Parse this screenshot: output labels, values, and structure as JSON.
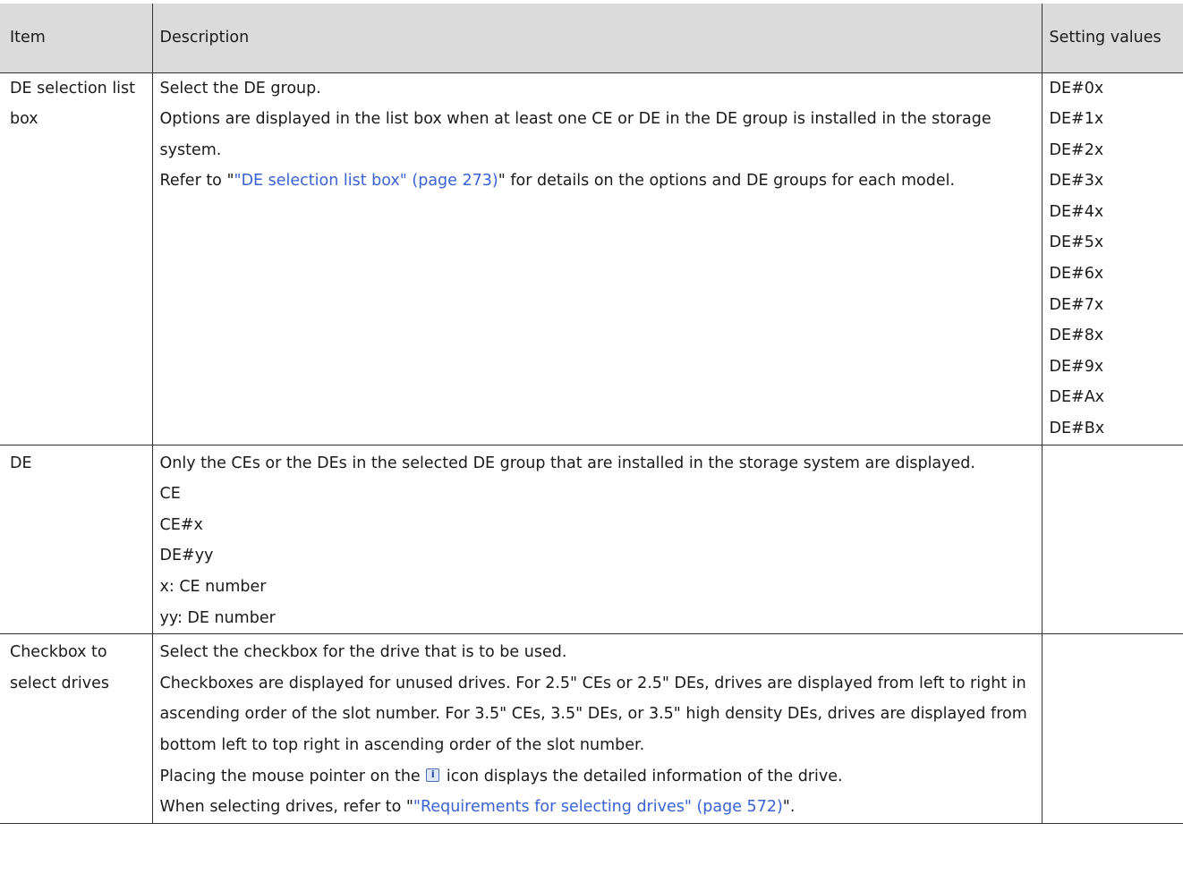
{
  "table": {
    "headers": {
      "item": "Item",
      "description": "Description",
      "setting_values": "Setting values"
    },
    "rows": [
      {
        "item": "DE selection list box",
        "description": {
          "line1": "Select the DE group.",
          "line2": "Options are displayed in the list box when at least one CE or DE in the DE group is installed in the storage system.",
          "ref_prefix": "Refer to \"",
          "ref_link": "\"DE selection list box\" (page 273)",
          "ref_suffix": "\" for details on the options and DE groups for each model."
        },
        "values": [
          "DE#0x",
          "DE#1x",
          "DE#2x",
          "DE#3x",
          "DE#4x",
          "DE#5x",
          "DE#6x",
          "DE#7x",
          "DE#8x",
          "DE#9x",
          "DE#Ax",
          "DE#Bx"
        ]
      },
      {
        "item": "DE",
        "description": {
          "line1": "Only the CEs or the DEs in the selected DE group that are installed in the storage system are displayed.",
          "list": [
            "CE",
            "CE#x",
            "DE#yy",
            "x: CE number",
            "yy: DE number"
          ]
        }
      },
      {
        "item": "Checkbox to select drives",
        "description": {
          "line1": "Select the checkbox for the drive that is to be used.",
          "line2": "Checkboxes are displayed for unused drives. For 2.5\" CEs or 2.5\" DEs, drives are displayed from left to right in ascending order of the slot number. For 3.5\" CEs, 3.5\" DEs, or 3.5\" high density DEs, drives are displayed from bottom left to top right in ascending order of the slot number.",
          "icon_prefix": "Placing the mouse pointer on the",
          "icon_name": "info-icon",
          "icon_suffix": "icon displays the detailed information of the drive.",
          "ref_prefix": "When selecting drives, refer to \"",
          "ref_link": "\"Requirements for selecting drives\" (page 572)",
          "ref_suffix": "\"."
        }
      }
    ]
  }
}
